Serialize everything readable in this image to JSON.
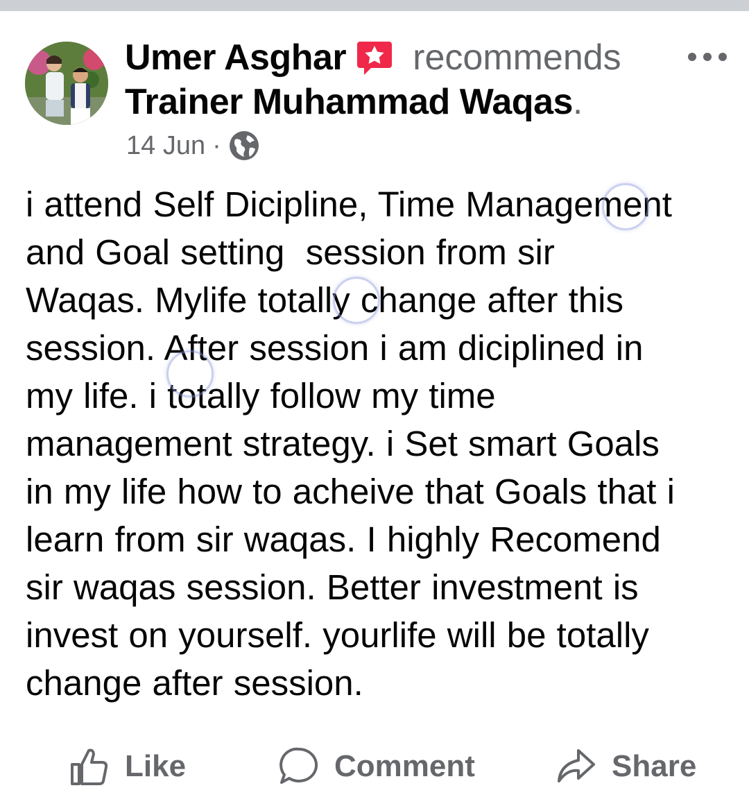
{
  "post": {
    "author": "Umer Asghar",
    "action_text": "recommends",
    "target": "Trainer Muhammad Waqas",
    "target_suffix": ".",
    "date": "14 Jun",
    "separator": "·",
    "privacy_icon": "globe-icon",
    "recommend_icon": "recommend-flag-icon",
    "body": "i attend Self Dicipline, Time Management\nand Goal setting  session from sir\nWaqas. Mylife totally change after this\nsession. After session i am diciplined in\nmy life. i totally follow my time\nmanagement strategy. i Set smart Goals\nin my life how to acheive that Goals that i\nlearn from sir waqas. I highly Recomend\nsir waqas session. Better investment is\ninvest on yourself. yourlife will be totally\nchange after session."
  },
  "actions": {
    "like_label": "Like",
    "comment_label": "Comment",
    "share_label": "Share"
  },
  "colors": {
    "recommend_badge": "#f02849",
    "secondary_text": "#65676b",
    "primary_text": "#050505"
  }
}
